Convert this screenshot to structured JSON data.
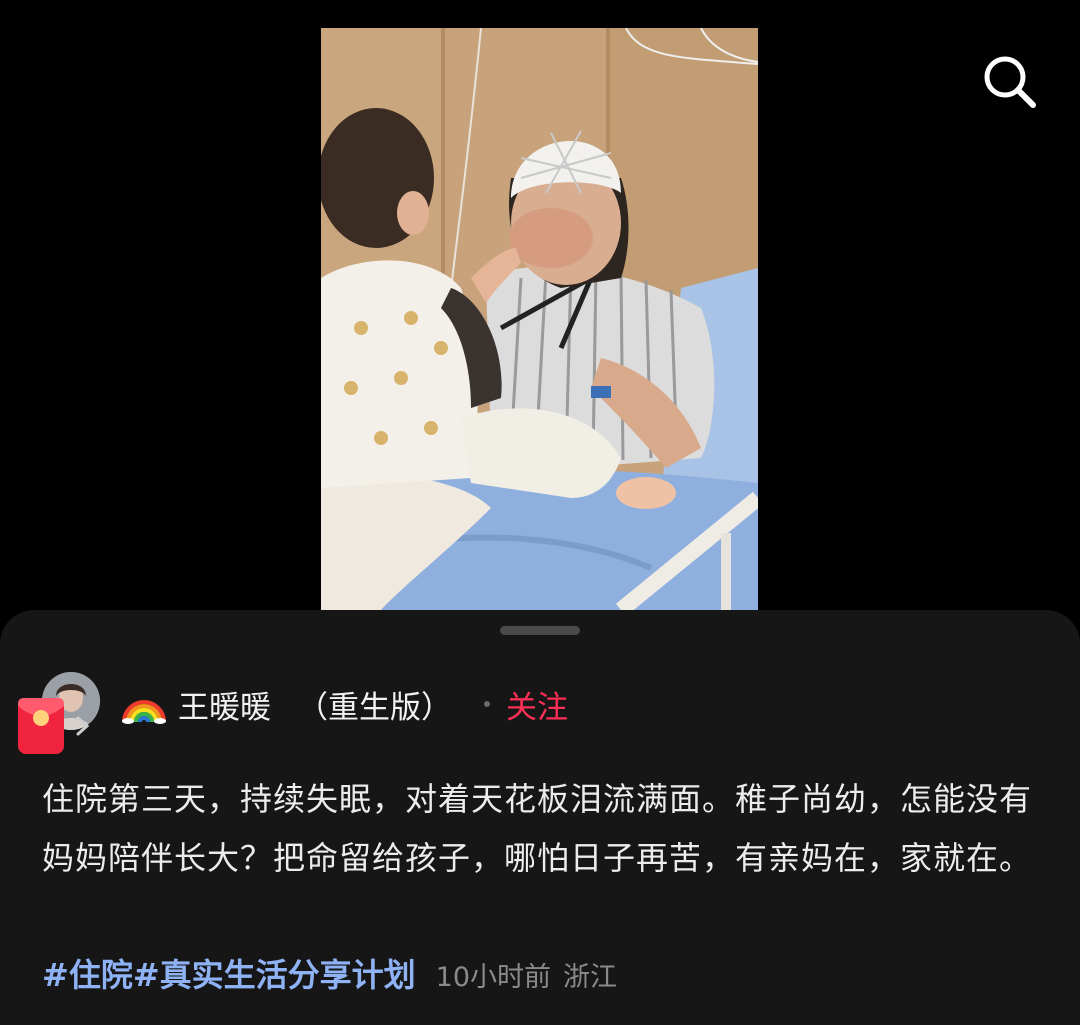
{
  "icons": {
    "search": "search-icon",
    "rainbow": "rainbow-icon",
    "red_packet": "red-packet-icon",
    "chevron": "chevron-right-icon"
  },
  "colors": {
    "background": "#000000",
    "sheet": "#161616",
    "follow": "#ff2e55",
    "hashtag": "#8fb2f5",
    "meta": "#8a8a8a"
  },
  "author": {
    "name": "王暖暖",
    "suffix": "（重生版）",
    "follow_label": "关注"
  },
  "post": {
    "caption": "住院第三天，持续失眠，对着天花板泪流满面。稚子尚幼，怎能没有妈妈陪伴长大？把命留给孩子，哪怕日子再苦，有亲妈在，家就在。",
    "hashtags": [
      "#住院",
      "#真实生活分享计划"
    ],
    "time": "10小时前",
    "location": "浙江"
  }
}
